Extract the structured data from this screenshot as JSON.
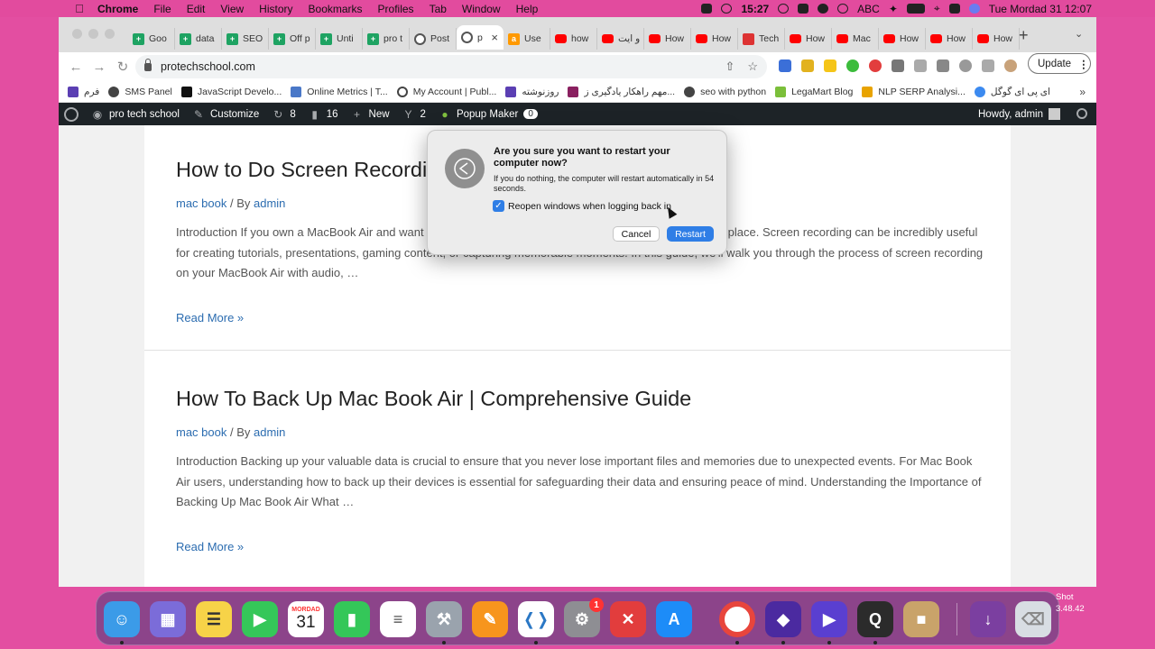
{
  "menubar": {
    "app": "Chrome",
    "items": [
      "File",
      "Edit",
      "View",
      "History",
      "Bookmarks",
      "Profiles",
      "Tab",
      "Window",
      "Help"
    ],
    "time_left": "15:27",
    "input_source": "ABC",
    "datetime": "Tue Mordad 31  12:07"
  },
  "tabs": [
    {
      "label": "Goo",
      "icon": "sheets"
    },
    {
      "label": "data",
      "icon": "sheets"
    },
    {
      "label": "SEO",
      "icon": "sheets"
    },
    {
      "label": "Off p",
      "icon": "sheets"
    },
    {
      "label": "Unti",
      "icon": "sheets"
    },
    {
      "label": "pro t",
      "icon": "sheets"
    },
    {
      "label": "Post",
      "icon": "globe"
    },
    {
      "label": "p",
      "icon": "globe",
      "active": true
    },
    {
      "label": "Use",
      "icon": "amazon"
    },
    {
      "label": "how",
      "icon": "youtube"
    },
    {
      "label": "و ایت",
      "icon": "youtube"
    },
    {
      "label": "How",
      "icon": "youtube"
    },
    {
      "label": "How",
      "icon": "youtube"
    },
    {
      "label": "Tech",
      "icon": "tech"
    },
    {
      "label": "How",
      "icon": "youtube"
    },
    {
      "label": "Mac",
      "icon": "youtube"
    },
    {
      "label": "How",
      "icon": "youtube"
    },
    {
      "label": "How",
      "icon": "youtube"
    },
    {
      "label": "How",
      "icon": "youtube"
    }
  ],
  "toolbar": {
    "url": "protechschool.com",
    "update_label": "Update"
  },
  "bookmarks": [
    "فرم",
    "SMS Panel",
    "JavaScript Develo...",
    "Online Metrics | T...",
    "My Account | Publ...",
    "روزنوشته",
    "مهم راهکار یادگیری ز...",
    "seo with python",
    "LegaMart Blog",
    "NLP SERP Analysi...",
    "ای پی ای گوگل"
  ],
  "adminbar": {
    "site": "pro tech school",
    "customize": "Customize",
    "updates": "8",
    "comments": "16",
    "new": "New",
    "yoast": "2",
    "popup": "Popup Maker",
    "popup_count": "0",
    "howdy": "Howdy, admin"
  },
  "posts": [
    {
      "title": "How to Do Screen Recording on MacBook Air with Audio",
      "category": "mac book",
      "by": " / By ",
      "author": "admin",
      "excerpt": "Introduction If you own a MacBook Air and want to record your screen with audio, you've come to the right place. Screen recording can be incredibly useful for creating tutorials, presentations, gaming content, or capturing memorable moments. In this guide, we'll walk you through the process of screen recording on your MacBook Air with audio, …",
      "read_more": "Read More »"
    },
    {
      "title": "How To Back Up Mac Book Air | Comprehensive Guide",
      "category": "mac book",
      "by": " / By ",
      "author": "admin",
      "excerpt": "Introduction Backing up your valuable data is crucial to ensure that you never lose important files and memories due to unexpected events. For Mac Book Air users, understanding how to back up their devices is essential for safeguarding their data and ensuring peace of mind. Understanding the Importance of Backing Up Mac Book Air What …",
      "read_more": "Read More »"
    }
  ],
  "dialog": {
    "title": "Are you sure you want to restart your computer now?",
    "message": "If you do nothing, the computer will restart automatically in 54 seconds.",
    "checkbox_label": "Reopen windows when logging back in",
    "checkbox_checked": true,
    "cancel": "Cancel",
    "restart": "Restart"
  },
  "dock": {
    "calendar_month": "MORDAD",
    "calendar_day": "31",
    "settings_badge": "1"
  },
  "desktop": {
    "shot_label": "Shot",
    "shot_time": "3.48.42"
  },
  "colors": {
    "accent": "#2f7ee6",
    "desktop": "#e34ea1",
    "admin_bar": "#1d2327",
    "link": "#2b6cb0"
  }
}
